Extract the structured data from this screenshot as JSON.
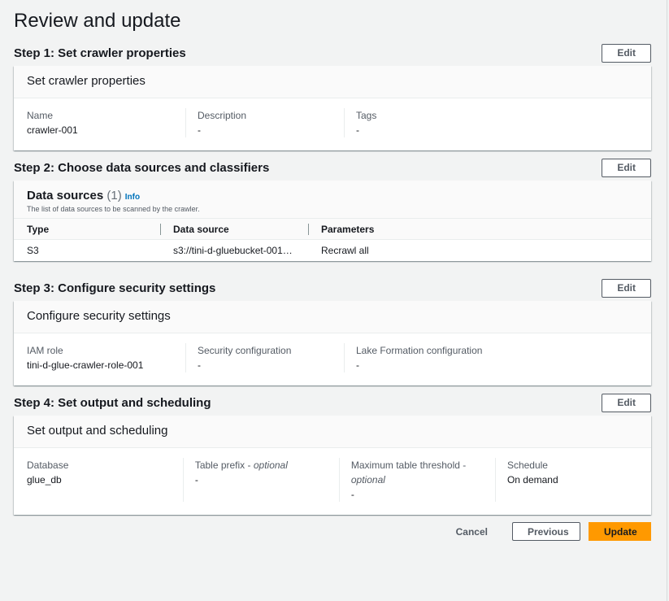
{
  "title": "Review and update",
  "edit": "Edit",
  "step1": {
    "title": "Step 1: Set crawler properties",
    "card": "Set crawler properties",
    "fields": [
      {
        "label": "Name",
        "value": "crawler-001"
      },
      {
        "label": "Description",
        "value": "-"
      },
      {
        "label": "Tags",
        "value": "-"
      }
    ]
  },
  "step2": {
    "title": "Step 2: Choose data sources and classifiers",
    "card": "Data sources",
    "count": "(1)",
    "info": "Info",
    "desc": "The list of data sources to be scanned by the crawler.",
    "columns": [
      "Type",
      "Data source",
      "Parameters"
    ],
    "rows": [
      [
        "S3",
        "s3://tini-d-gluebucket-001…",
        "Recrawl all"
      ]
    ]
  },
  "step3": {
    "title": "Step 3: Configure security settings",
    "card": "Configure security settings",
    "fields": [
      {
        "label": "IAM role",
        "value": "tini-d-glue-crawler-role-001"
      },
      {
        "label": "Security configuration",
        "value": "-"
      },
      {
        "label": "Lake Formation configuration",
        "value": "-"
      }
    ]
  },
  "step4": {
    "title": "Step 4: Set output and scheduling",
    "card": "Set output and scheduling",
    "fields": [
      {
        "label": "Database",
        "value": "glue_db"
      },
      {
        "label": "Table prefix - ",
        "optional": "optional",
        "value": "-"
      },
      {
        "label": "Maximum table threshold - ",
        "optional": "optional",
        "value": "-"
      },
      {
        "label": "Schedule",
        "value": "On demand"
      }
    ]
  },
  "footer": {
    "cancel": "Cancel",
    "previous": "Previous",
    "update": "Update"
  }
}
